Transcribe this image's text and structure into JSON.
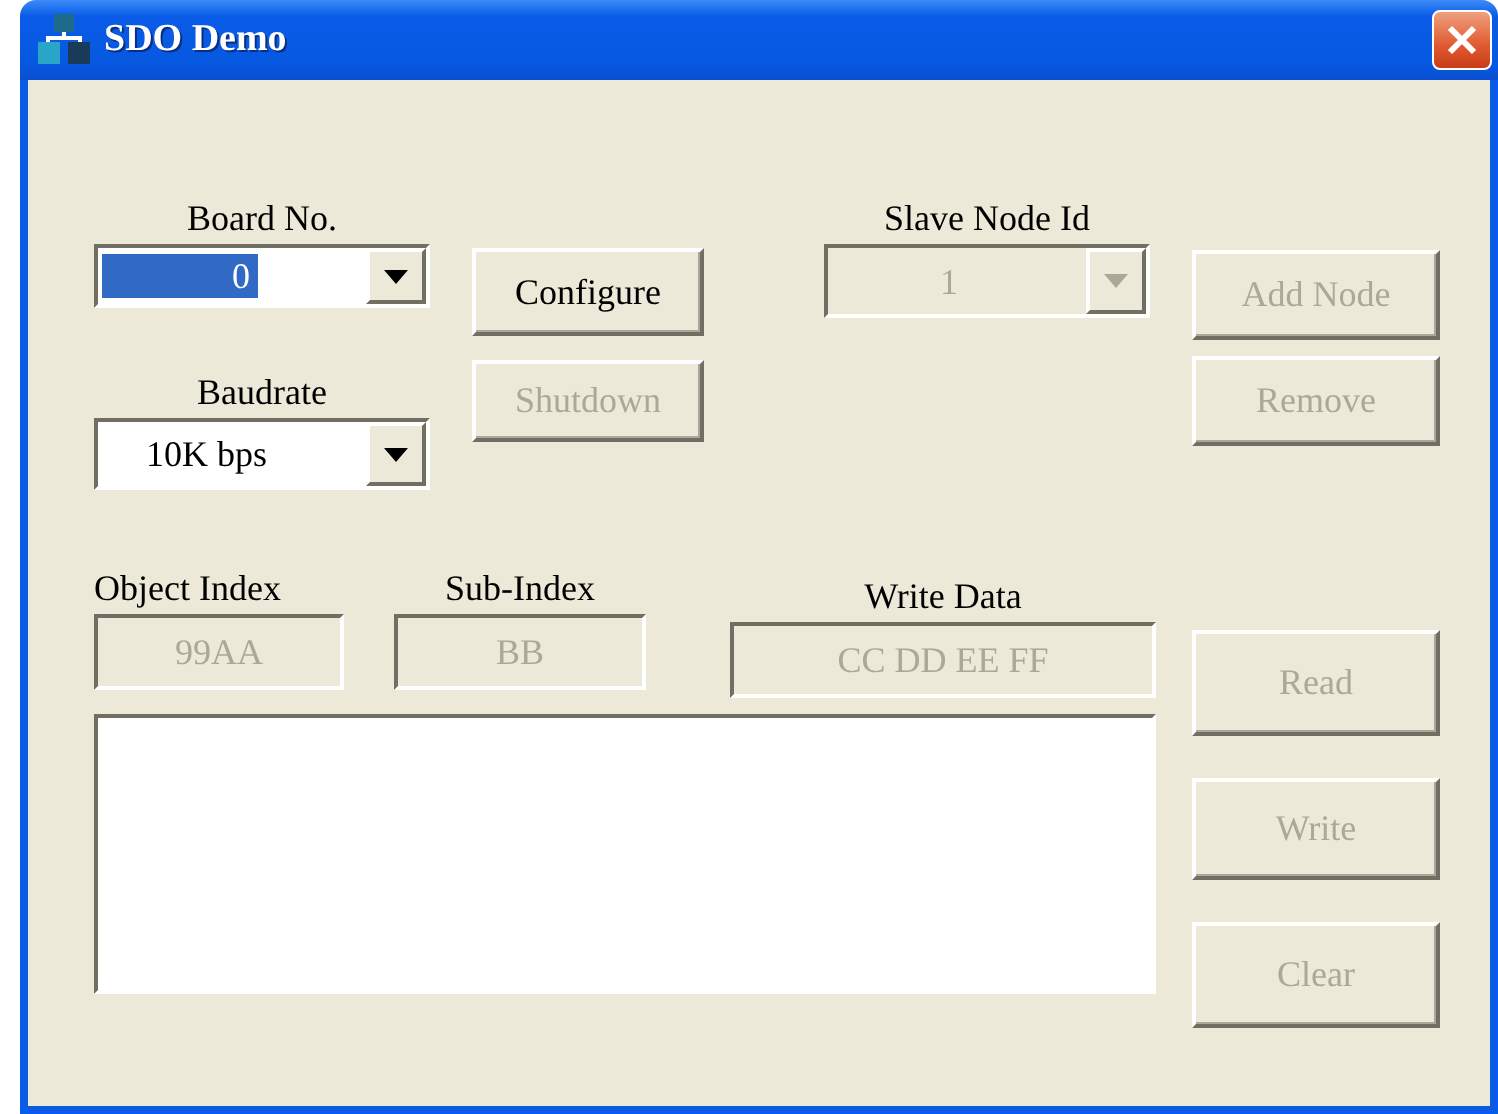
{
  "window": {
    "title": "SDO Demo"
  },
  "board_no": {
    "label": "Board No.",
    "value": "0",
    "highlighted": true,
    "disabled": false
  },
  "configure": {
    "label": "Configure",
    "disabled": false
  },
  "slave_node_id": {
    "label": "Slave Node Id",
    "value": "1",
    "highlighted": false,
    "disabled": true
  },
  "add_node": {
    "label": "Add Node",
    "disabled": true
  },
  "baudrate": {
    "label": "Baudrate",
    "value": "10K bps",
    "highlighted": false,
    "disabled": false
  },
  "shutdown": {
    "label": "Shutdown",
    "disabled": true
  },
  "remove": {
    "label": "Remove",
    "disabled": true
  },
  "object_index": {
    "label": "Object Index",
    "value": "99AA",
    "disabled": true
  },
  "sub_index": {
    "label": "Sub-Index",
    "value": "BB",
    "disabled": true
  },
  "write_data": {
    "label": "Write Data",
    "value": "CC DD EE FF",
    "disabled": true
  },
  "read": {
    "label": "Read",
    "disabled": true
  },
  "write": {
    "label": "Write",
    "disabled": true
  },
  "clear": {
    "label": "Clear",
    "disabled": true
  }
}
